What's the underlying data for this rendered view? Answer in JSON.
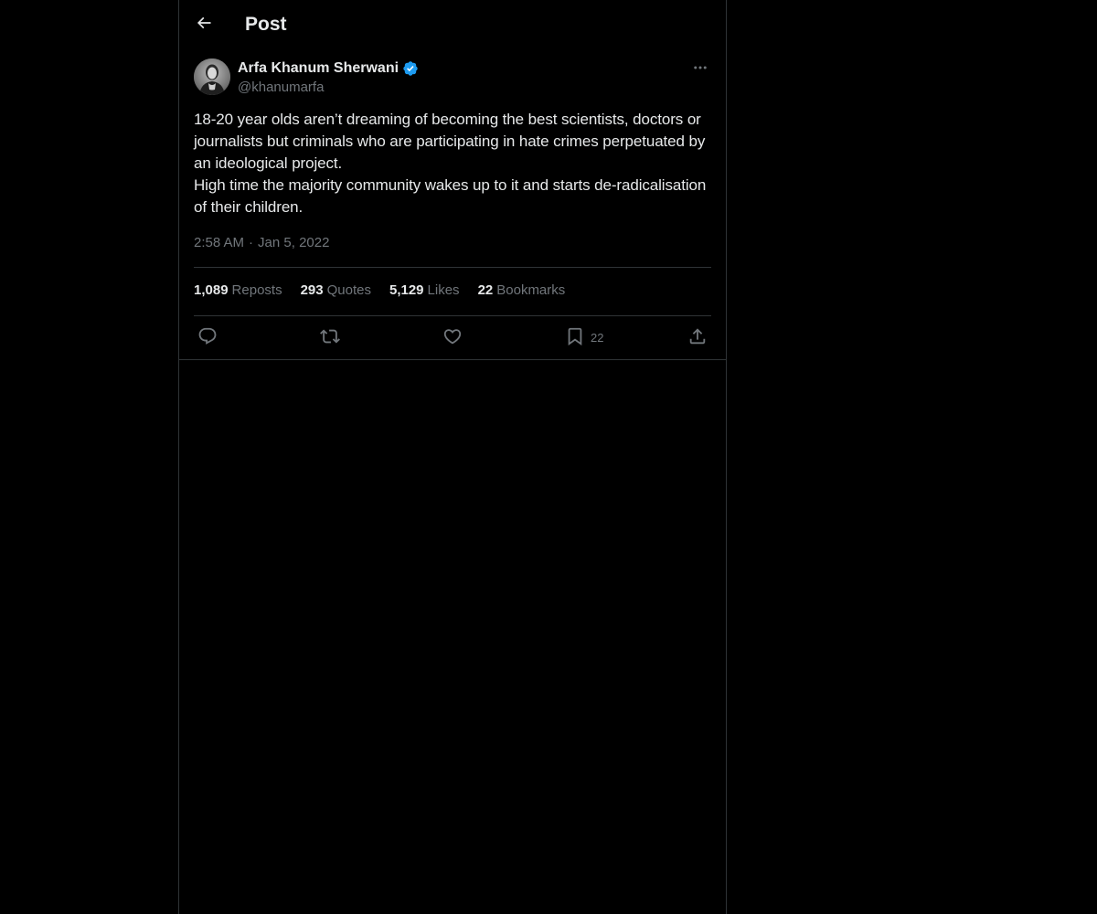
{
  "header": {
    "title": "Post",
    "back_icon": "arrow-left-icon"
  },
  "author": {
    "name": "Arfa Khanum Sherwani",
    "handle": "@khanumarfa",
    "verified": true,
    "verified_color": "#1d9bf0"
  },
  "tweet": {
    "lines": [
      "18-20 year olds aren’t dreaming of becoming the best scientists, doctors or journalists but criminals who are participating in hate crimes perpetuated by an ideological project.",
      "High time the majority community wakes up to it and starts de-radicalisation of their children."
    ],
    "time": "2:58 AM",
    "separator": "·",
    "date": "Jan 5, 2022"
  },
  "stats": {
    "reposts_count": "1,089",
    "reposts_label": "Reposts",
    "quotes_count": "293",
    "quotes_label": "Quotes",
    "likes_count": "5,129",
    "likes_label": "Likes",
    "bookmarks_count": "22",
    "bookmarks_label": "Bookmarks"
  },
  "actions": {
    "reply_icon": "reply-icon",
    "repost_icon": "repost-icon",
    "like_icon": "heart-icon",
    "bookmark_icon": "bookmark-icon",
    "bookmark_count": "22",
    "share_icon": "share-icon"
  },
  "colors": {
    "background": "#000000",
    "text_primary": "#e7e9ea",
    "text_secondary": "#71767b",
    "border": "#2f3336",
    "accent": "#1d9bf0"
  }
}
